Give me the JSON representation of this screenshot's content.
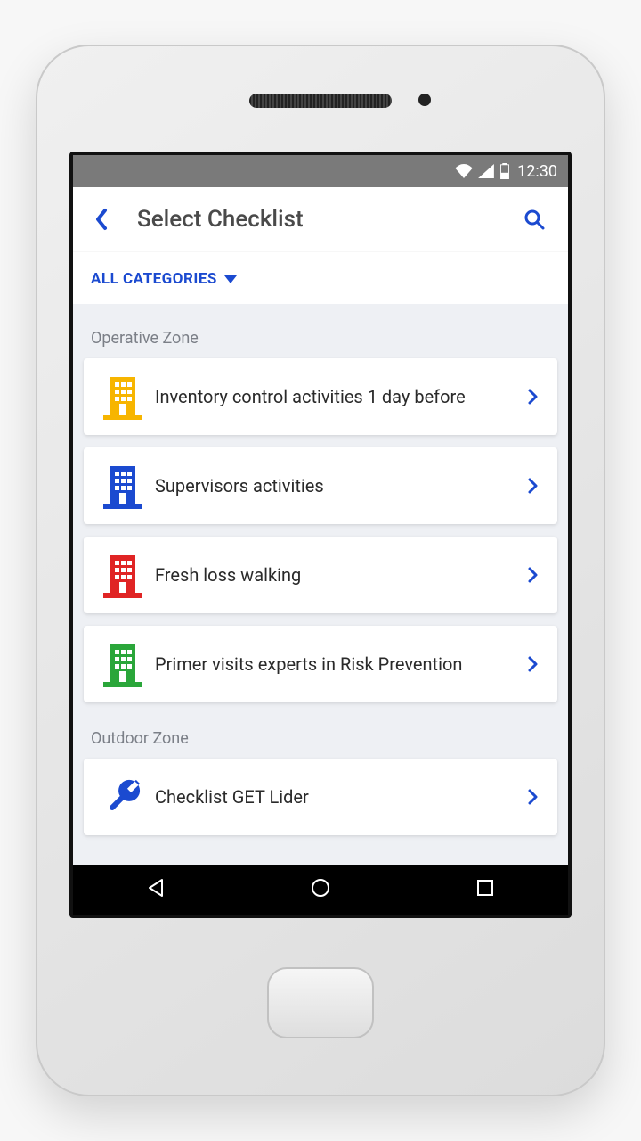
{
  "status_bar": {
    "time": "12:30"
  },
  "header": {
    "title": "Select Checklist"
  },
  "filter": {
    "label": "ALL CATEGORIES"
  },
  "sections": [
    {
      "title": "Operative Zone",
      "items": [
        {
          "label": "Inventory control activities 1 day before",
          "icon": "building",
          "color": "#f7b500"
        },
        {
          "label": "Supervisors activities",
          "icon": "building",
          "color": "#1b4ad0"
        },
        {
          "label": "Fresh loss walking",
          "icon": "building",
          "color": "#e02424"
        },
        {
          "label": "Primer visits experts in Risk Prevention",
          "icon": "building",
          "color": "#2aa63a"
        }
      ]
    },
    {
      "title": "Outdoor Zone",
      "items": [
        {
          "label": "Checklist GET Lider",
          "icon": "wrench",
          "color": "#1b4ad0"
        }
      ]
    }
  ]
}
